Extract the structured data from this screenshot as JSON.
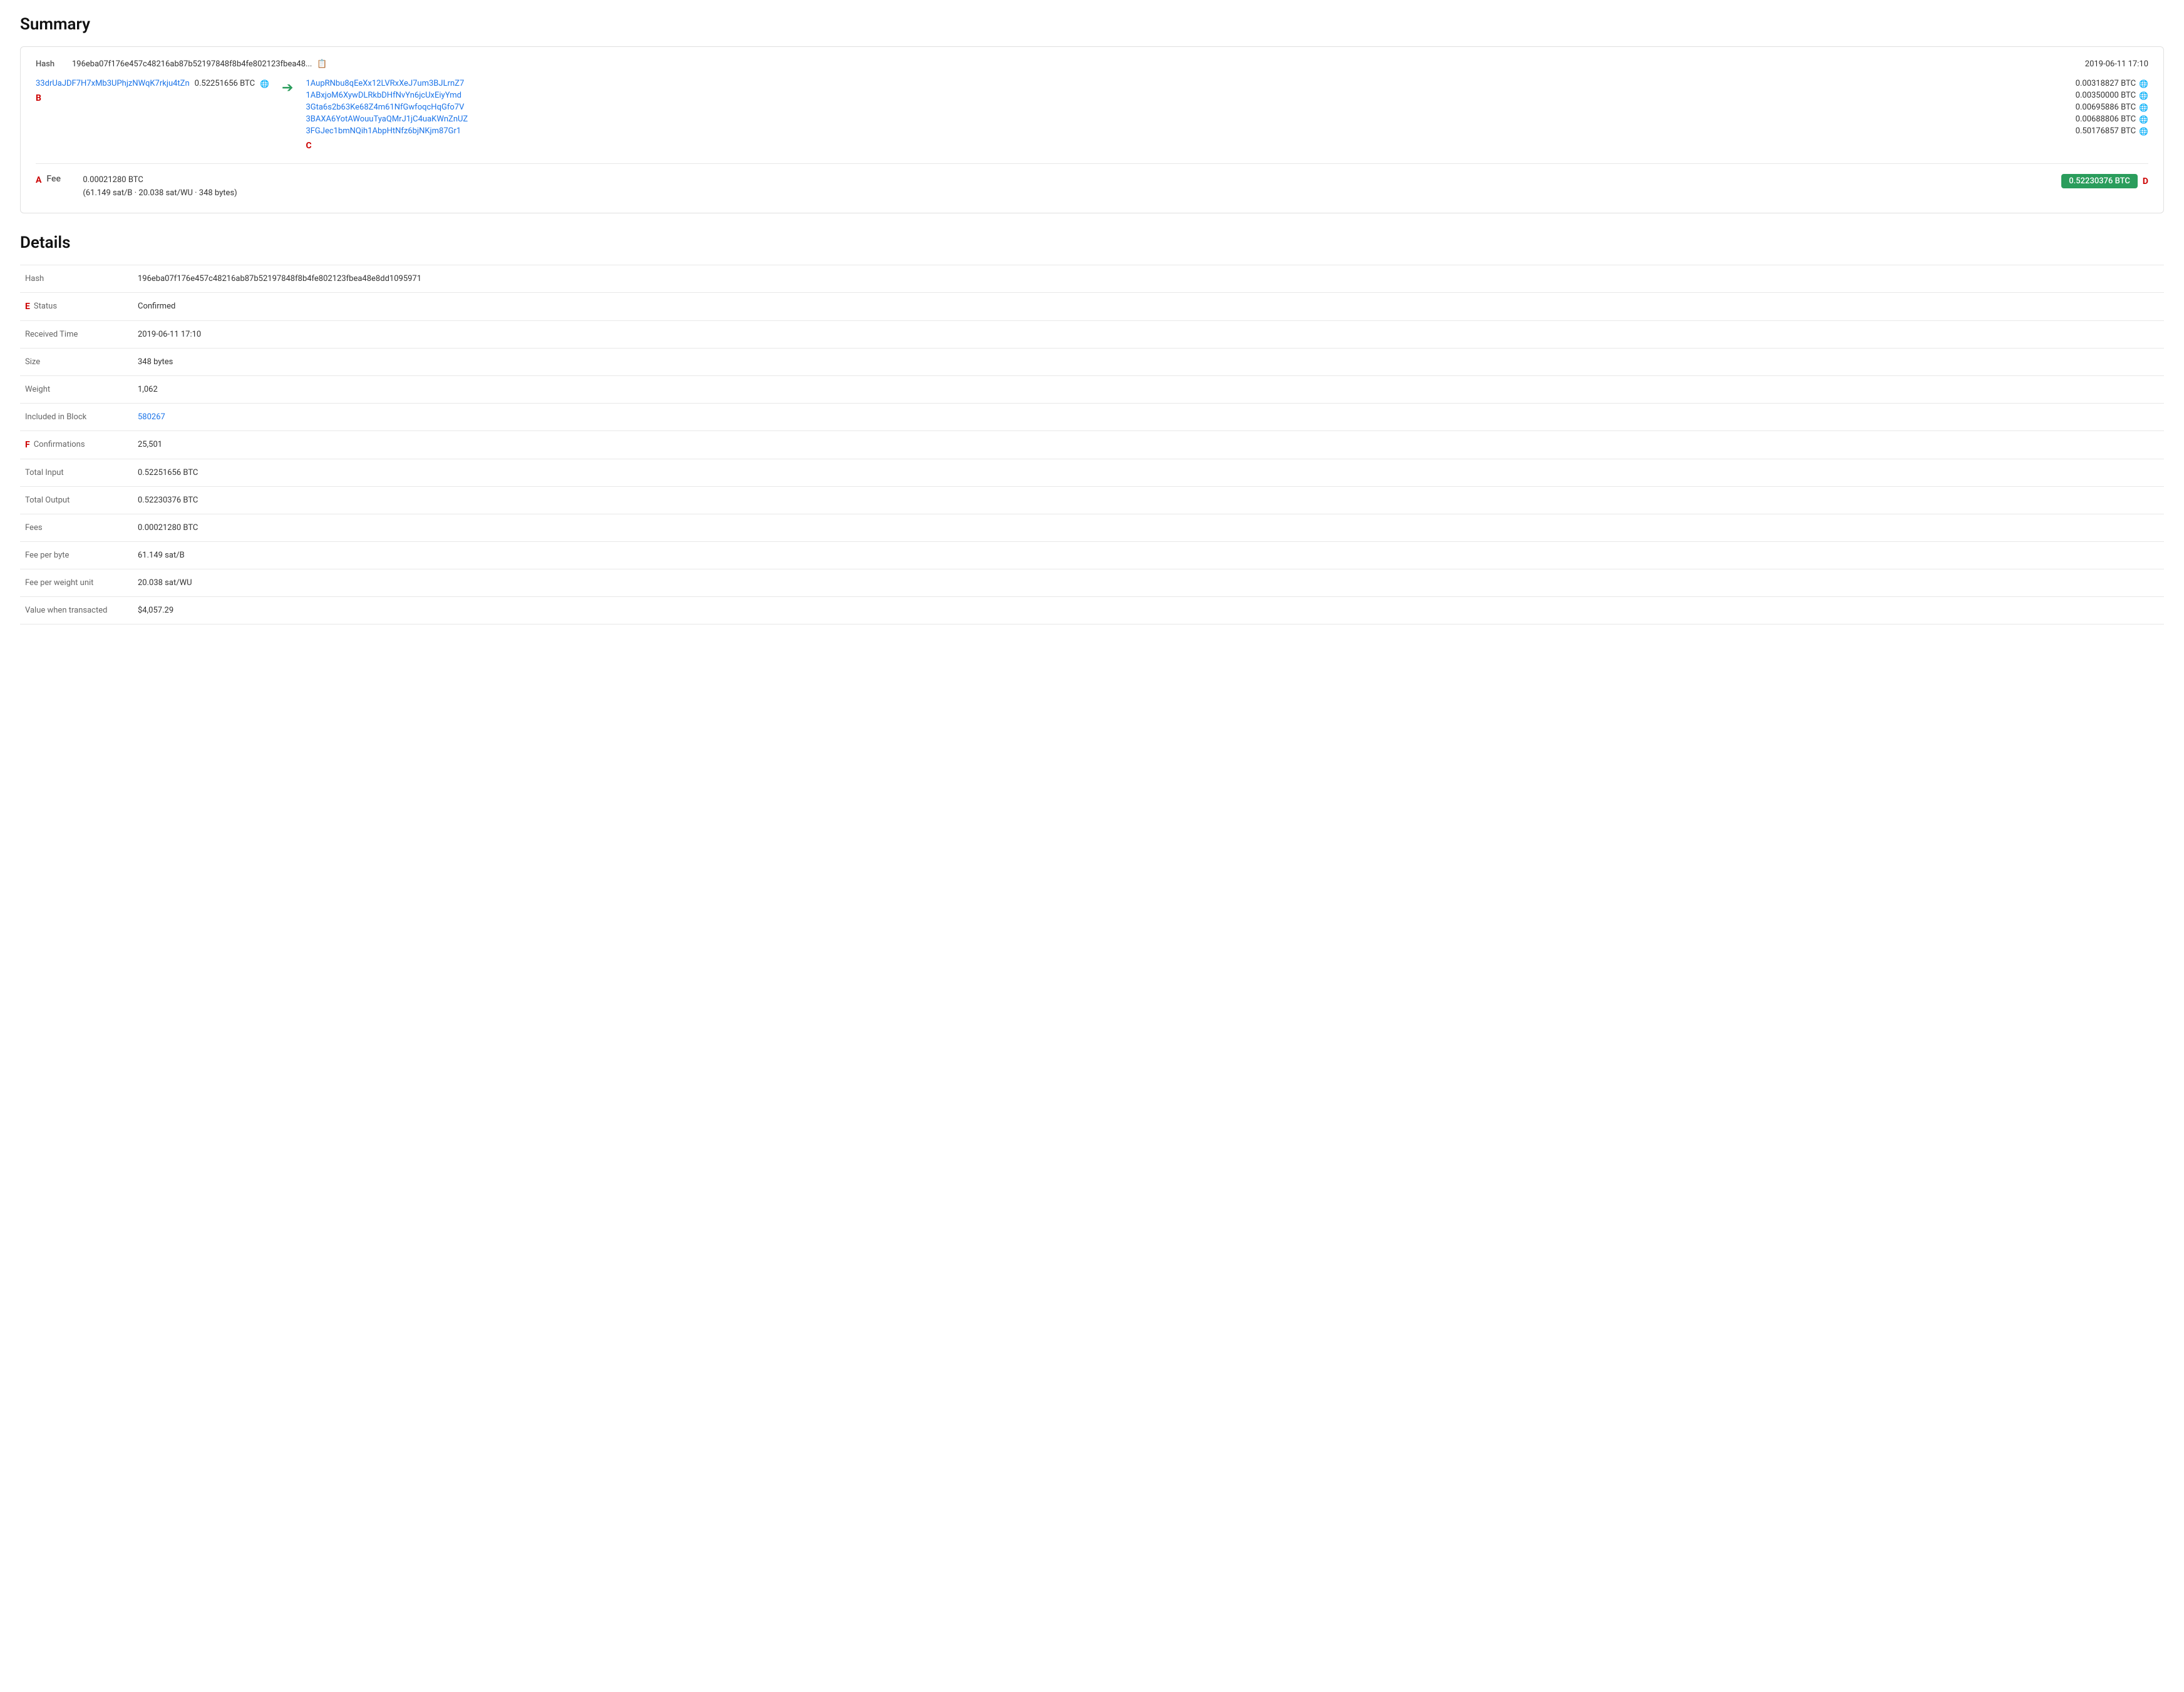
{
  "summary": {
    "title": "Summary",
    "hash_short": "196eba07f176e457c48216ab87b52197848f8b4fe802123fbea48...",
    "hash_full": "196eba07f176e457c48216ab87b52197848f8b4fe802123fbea48e8dd1095971",
    "timestamp": "2019-06-11 17:10",
    "input_address": "33drUaJDF7H7xMb3UPhjzNWqK7rkju4tZn",
    "input_amount": "0.52251656 BTC",
    "outputs": [
      {
        "address": "1AupRNbu8qEeXx12LVRxXeJ7um3BJLrnZ7",
        "amount": "0.00318827 BTC"
      },
      {
        "address": "1ABxjoM6XywDLRkbDHfNvYn6jcUxEiyYmd",
        "amount": "0.00350000 BTC"
      },
      {
        "address": "3Gta6s2b63Ke68Z4m61NfGwfoqcHqGfo7V",
        "amount": "0.00695886 BTC"
      },
      {
        "address": "3BAXA6YotAWouuTyaQMrJ1jC4uaKWnZnUZ",
        "amount": "0.00688806 BTC"
      },
      {
        "address": "3FGJec1bmNQih1AbpHtNfz6bjNKjm87Gr1",
        "amount": "0.50176857 BTC"
      }
    ],
    "fee_btc": "0.00021280 BTC",
    "fee_detail": "(61.149 sat/B · 20.038 sat/WU · 348 bytes)",
    "total_output": "0.52230376 BTC",
    "labels": {
      "A": "A",
      "B": "B",
      "C": "C",
      "D": "D"
    }
  },
  "details": {
    "title": "Details",
    "rows": [
      {
        "label": "Hash",
        "value": "196eba07f176e457c48216ab87b52197848f8b4fe802123fbea48e8dd1095971"
      },
      {
        "label": "Status",
        "value": "Confirmed",
        "type": "link-blue"
      },
      {
        "label": "Received Time",
        "value": "2019-06-11 17:10"
      },
      {
        "label": "Size",
        "value": "348 bytes"
      },
      {
        "label": "Weight",
        "value": "1,062"
      },
      {
        "label": "Included in Block",
        "value": "580267",
        "type": "link-blue"
      },
      {
        "label": "Confirmations",
        "value": "25,501"
      },
      {
        "label": "Total Input",
        "value": "0.52251656 BTC"
      },
      {
        "label": "Total Output",
        "value": "0.52230376 BTC"
      },
      {
        "label": "Fees",
        "value": "0.00021280 BTC"
      },
      {
        "label": "Fee per byte",
        "value": "61.149 sat/B"
      },
      {
        "label": "Fee per weight unit",
        "value": "20.038 sat/WU"
      },
      {
        "label": "Value when transacted",
        "value": "$4,057.29"
      }
    ],
    "labels": {
      "E": "E",
      "F": "F"
    }
  }
}
